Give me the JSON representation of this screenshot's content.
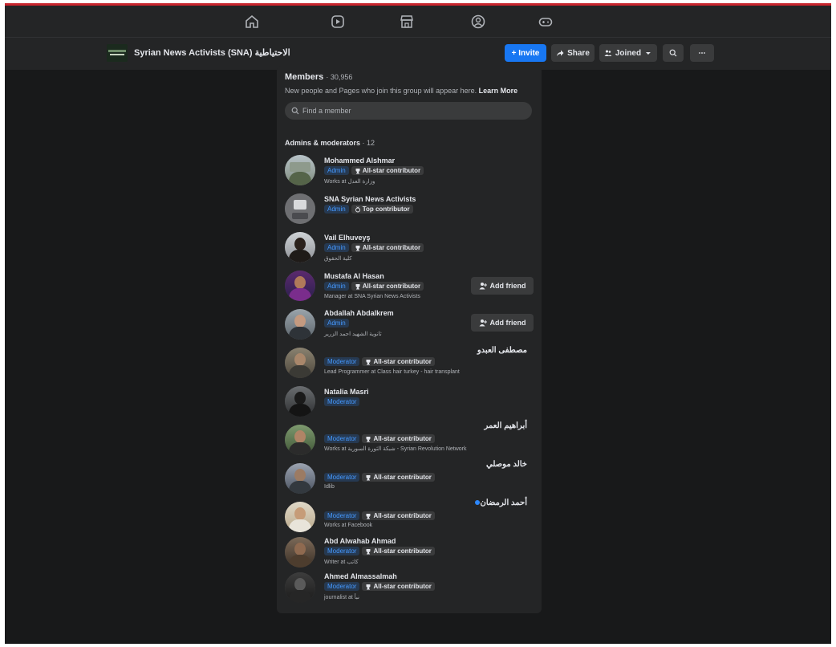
{
  "nav": {
    "icons": [
      "home-icon",
      "video-icon",
      "marketplace-icon",
      "groups-icon",
      "gaming-icon"
    ]
  },
  "group": {
    "title": "Syrian News Activists (SNA) الاحتياطية",
    "invite_label": "+ Invite",
    "share_label": "Share",
    "joined_label": "Joined"
  },
  "members_panel": {
    "title": "Members",
    "count": "· 30,956",
    "subtitle": "New people and Pages who join this group will appear here.",
    "learn_more": "Learn More",
    "search_placeholder": "Find a member",
    "section_title": "Admins & moderators",
    "section_count": "· 12",
    "add_friend_label": "Add friend",
    "members": [
      {
        "name": "Mohammed Alshmar",
        "role": "Admin",
        "contributor": "All-star contributor",
        "info": "Works at وزارة العدل"
      },
      {
        "name": "SNA Syrian News Activists",
        "role": "Admin",
        "contributor": "Top contributor",
        "info": ""
      },
      {
        "name": "Vail Elhuveyş",
        "role": "Admin",
        "contributor": "All-star contributor",
        "info": "كلية الحقوق"
      },
      {
        "name": "Mustafa Al Hasan",
        "role": "Admin",
        "contributor": "All-star contributor",
        "info": "Manager at SNA Syrian News Activists"
      },
      {
        "name": "Abdallah Abdalkrem",
        "role": "Admin",
        "contributor": "",
        "info": "ثانوية الشهيد احمد الزرير"
      },
      {
        "name": "مصطفى العبدو",
        "role": "Moderator",
        "contributor": "All-star contributor",
        "info": "Lead Programmer at Class hair turkey - hair transplant"
      },
      {
        "name": "Natalia Masri",
        "role": "Moderator",
        "contributor": "",
        "info": ""
      },
      {
        "name": "أبراهيم العمر",
        "role": "Moderator",
        "contributor": "All-star contributor",
        "info": "Works at شبكة الثورة السورية - Syrian Revolution Network"
      },
      {
        "name": "خالد موصلي",
        "role": "Moderator",
        "contributor": "All-star contributor",
        "info": "Idlib"
      },
      {
        "name": "أحمد الرمضان",
        "role": "Moderator",
        "contributor": "All-star contributor",
        "info": "Works at Facebook"
      },
      {
        "name": "Abd Alwahab Ahmad",
        "role": "Moderator",
        "contributor": "All-star contributor",
        "info": "Writer at كاتب"
      },
      {
        "name": "Ahmed Almassalmah",
        "role": "Moderator",
        "contributor": "All-star contributor",
        "info": "journalist at نبأ"
      }
    ]
  },
  "colors": {
    "background": "#18191a",
    "surface": "#242526",
    "accent": "#1877f2",
    "role_badge_text": "#4599ff",
    "online": "#2d88ff"
  }
}
